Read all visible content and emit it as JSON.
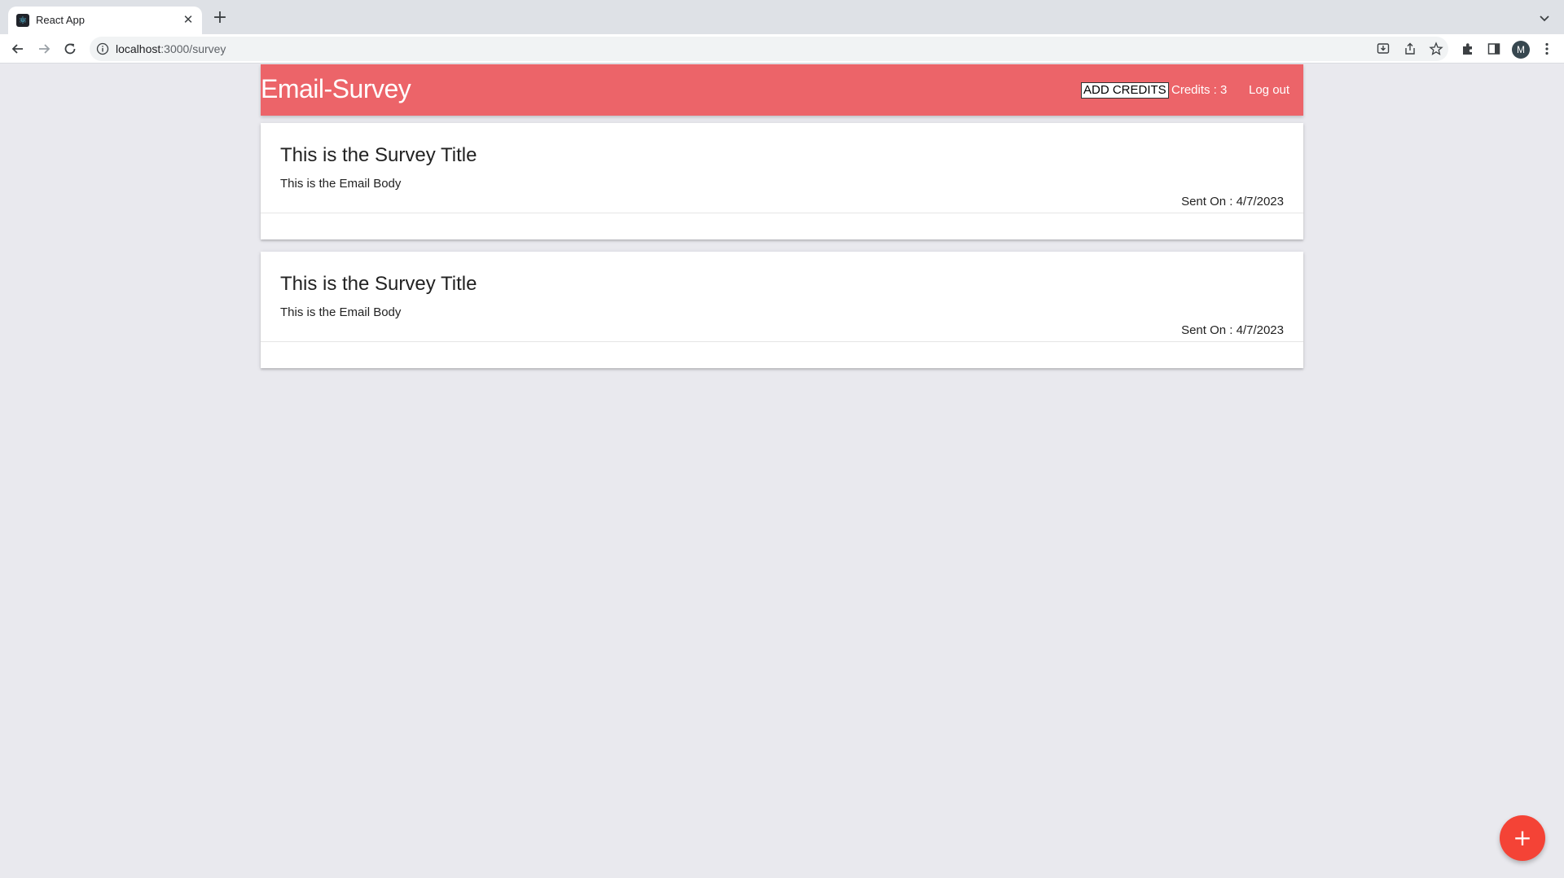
{
  "browser": {
    "tab_title": "React App",
    "tab_favicon": "react-logo-icon",
    "url_host": "localhost",
    "url_path": ":3000/survey",
    "profile_initial": "M"
  },
  "header": {
    "brand": "Email-Survey",
    "add_credits_label": "ADD CREDITS",
    "credits_label": "Credits : 3",
    "logout_label": "Log out",
    "background_color": "#ec6469"
  },
  "surveys": [
    {
      "title": "This is the Survey Title",
      "body": "This is the Email Body",
      "sent_on": "Sent On : 4/7/2023"
    },
    {
      "title": "This is the Survey Title",
      "body": "This is the Email Body",
      "sent_on": "Sent On : 4/7/2023"
    }
  ],
  "fab": {
    "icon": "plus-icon",
    "glyph": "+",
    "color": "#f44336"
  }
}
